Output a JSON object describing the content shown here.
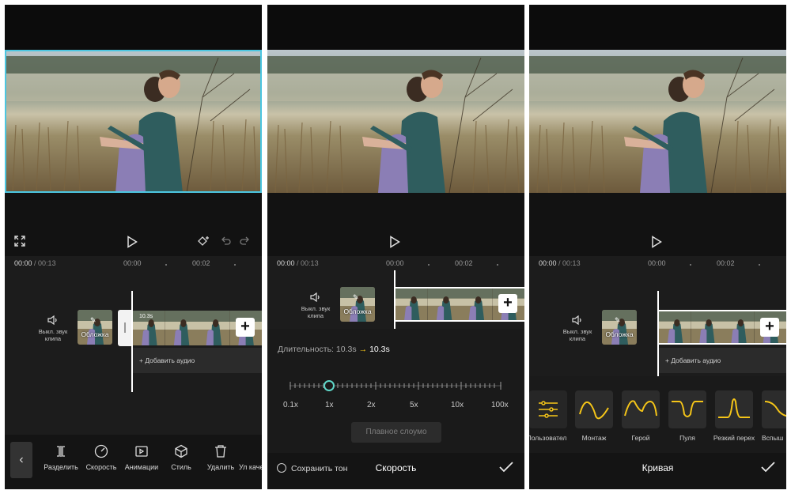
{
  "colors": {
    "accent_cyan": "#4cc6e0",
    "accent_yellow": "#f5c518",
    "background": "#101010"
  },
  "panel1": {
    "time_current": "00:00",
    "time_total": "/ 00:13",
    "ticks": [
      "00:00",
      "00:02"
    ],
    "mute_label": "Выкл. звук клипа",
    "cover_label": "Обложка",
    "clip_badge": "10.3s",
    "add_audio": "+ Добавить аудио",
    "tools": [
      {
        "label": "Разделить",
        "icon": "split-icon"
      },
      {
        "label": "Скорость",
        "icon": "speed-icon"
      },
      {
        "label": "Анимации",
        "icon": "animation-icon"
      },
      {
        "label": "Стиль",
        "icon": "style-icon"
      },
      {
        "label": "Удалить",
        "icon": "delete-icon"
      },
      {
        "label": "Ул качес",
        "icon": "enhance-icon"
      }
    ]
  },
  "panel2": {
    "time_current": "00:00",
    "time_total": "/ 00:13",
    "ticks": [
      "00:00",
      "00:02"
    ],
    "mute_label": "Выкл. звук клипа",
    "cover_label": "Обложка",
    "duration_label": "Длительность: 10.3s",
    "duration_arrow": "→",
    "duration_new": "10.3s",
    "scale": [
      "0.1x",
      "1x",
      "2x",
      "5x",
      "10x",
      "100x"
    ],
    "speed_value": "1x",
    "smooth_button": "Плавное слоумо",
    "keep_tone": "Сохранить тон",
    "title": "Скорость"
  },
  "panel3": {
    "time_current": "00:00",
    "time_total": "/ 00:13",
    "ticks": [
      "00:00",
      "00:02"
    ],
    "mute_label": "Выкл. звук клипа",
    "cover_label": "Обложка",
    "add_audio": "+ Добавить аудио",
    "curves": [
      "Пользовател",
      "Монтаж",
      "Герой",
      "Пуля",
      "Резкий перех",
      "Вспыш"
    ],
    "title": "Кривая"
  }
}
